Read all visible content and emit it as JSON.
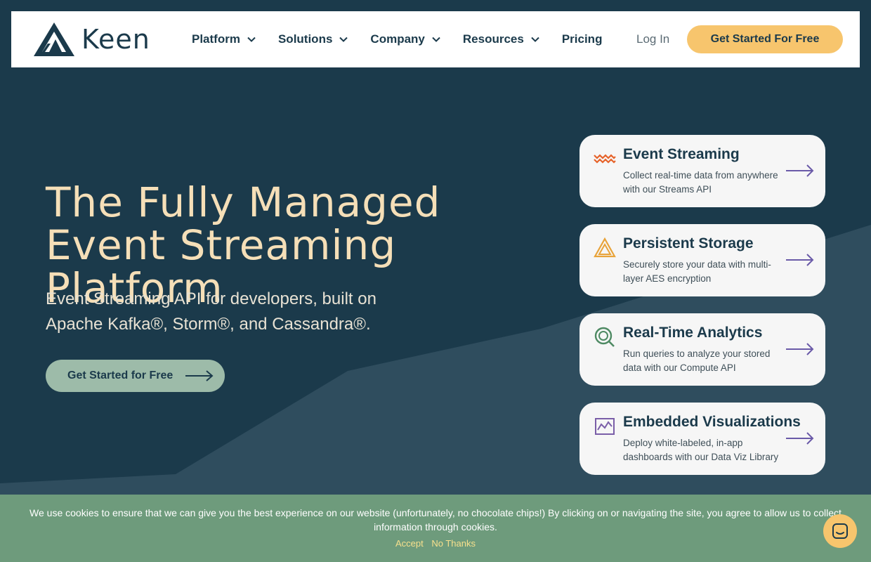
{
  "brand": {
    "name": "Keen"
  },
  "nav": {
    "items": [
      {
        "label": "Platform",
        "has_dropdown": true
      },
      {
        "label": "Solutions",
        "has_dropdown": true
      },
      {
        "label": "Company",
        "has_dropdown": true
      },
      {
        "label": "Resources",
        "has_dropdown": true
      },
      {
        "label": "Pricing",
        "has_dropdown": false
      }
    ],
    "login_label": "Log In",
    "cta_label": "Get Started For Free"
  },
  "hero": {
    "title": "The Fully Managed Event Streaming Platform",
    "subtitle": "Event Streaming API for developers, built on Apache Kafka®, Storm®, and Cassandra®.",
    "cta_label": "Get Started for Free"
  },
  "features": [
    {
      "title": "Event Streaming",
      "description": "Collect real-time data from anywhere with our Streams API",
      "icon": "wave-icon",
      "icon_color": "#e6632a"
    },
    {
      "title": "Persistent Storage",
      "description": "Securely store your data with multi-layer AES encryption",
      "icon": "triangle-icon",
      "icon_color": "#e8a33a"
    },
    {
      "title": "Real-Time Analytics",
      "description": "Run queries to analyze your stored data with our Compute API",
      "icon": "query-icon",
      "icon_color": "#4e8a63"
    },
    {
      "title": "Embedded Visualizations",
      "description": "Deploy white-labeled, in-app dashboards with our Data Viz Library",
      "icon": "chart-icon",
      "icon_color": "#7a5ea8"
    }
  ],
  "cookie": {
    "text": "We use cookies to ensure that we can give you the best experience on our website (unfortunately, no chocolate chips!) By clicking on or navigating the site, you agree to allow us to collect information through cookies.",
    "accept_label": "Accept",
    "decline_label": "No Thanks"
  },
  "colors": {
    "background": "#1b3a4b",
    "accent_yellow": "#f7c56d",
    "hero_title": "#f5dfb8",
    "hero_cta": "#9dbba9",
    "cookie_bar": "#6e9b7c",
    "arrow_purple": "#6a5aa8"
  }
}
